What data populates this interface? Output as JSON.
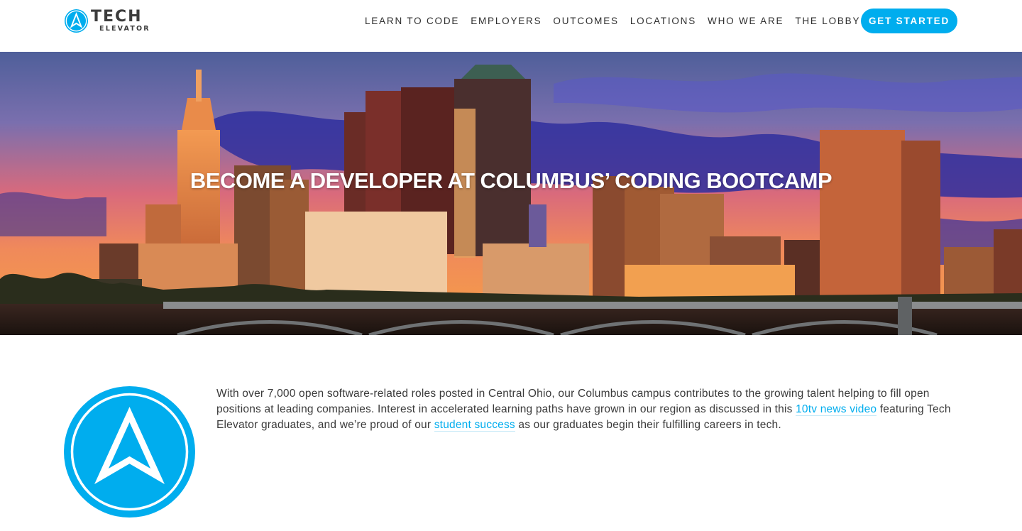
{
  "brand": {
    "name_line1": "TECH",
    "name_line2": "ELEVATOR",
    "accent_color": "#00adee",
    "logo_icon": "tech-elevator-arrow-icon"
  },
  "nav": {
    "items": [
      {
        "label": "LEARN TO CODE"
      },
      {
        "label": "EMPLOYERS"
      },
      {
        "label": "OUTCOMES"
      },
      {
        "label": "LOCATIONS"
      },
      {
        "label": "WHO WE ARE"
      },
      {
        "label": "THE LOBBY"
      }
    ],
    "cta_label": "GET STARTED"
  },
  "hero": {
    "title": "BECOME A DEVELOPER AT COLUMBUS’ CODING BOOTCAMP",
    "image": "columbus-skyline-at-sunset"
  },
  "intro": {
    "text_before_link1": "With over 7,000 open software-related roles posted in Central Ohio, our Columbus campus contributes to the growing talent helping to fill open positions at leading companies. Interest in accelerated learning paths have grown in our region as discussed in this ",
    "link1_label": "10tv news video",
    "text_between_links": " featuring Tech Elevator graduates, and we’re proud of our ",
    "link2_label": "student success",
    "text_after_link2": " as our graduates begin their fulfilling careers in tech."
  }
}
